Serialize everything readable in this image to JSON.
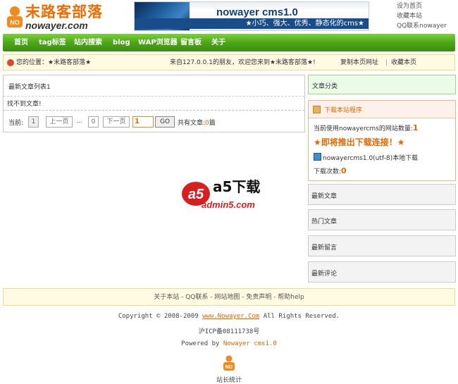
{
  "site": {
    "logo_title": "末路客部落",
    "logo_domain": "nowayer.com",
    "banner_title": "nowayer cms1.0",
    "banner_sub": "★小巧、强大、优秀、静态化的cms★",
    "toplinks": [
      "设为首页",
      "收藏本站",
      "QQ联系nowayer"
    ]
  },
  "nav": {
    "items": [
      "首页",
      "tag标签",
      "站内搜索",
      "blog",
      "WAP浏览器",
      "留言板",
      "关于"
    ]
  },
  "crumb": {
    "location": "您的位置：★末路客部落★",
    "welcome": "来自127.0.0.1的朋友，欢迎您来到★末路客部落★!",
    "copy_url": "复制本页网址",
    "separator": "|",
    "bookmark": "收藏本页"
  },
  "main": {
    "list_title": "最新文章列表1",
    "empty_text": "找不到文章!",
    "pager": {
      "label": "当前:",
      "current": "1",
      "prev": "上一页",
      "ellipsis": "...",
      "total_pages": "0",
      "next": "下一页",
      "input_value": "1",
      "go": "GO",
      "total_label": "共有文章:",
      "total_count": "0",
      "total_unit": "篇"
    }
  },
  "sidebar": {
    "category_title": "文章分类",
    "download": {
      "title": "下载本站程序",
      "count_label": "当前使用nowayercms的网站数量:",
      "count_value": "1",
      "announce": "★即将推出下载连接！★",
      "file_label": "nowayercms1.0(utf-8)本地下载",
      "dl_label": "下载次数:",
      "dl_value": "0"
    },
    "boxes": [
      "最新文章",
      "热门文章",
      "最新留言",
      "最新评论"
    ]
  },
  "watermark": {
    "brand": "a5下载",
    "domain": "admin5.com"
  },
  "footer": {
    "links": "关于本站 - QQ联系 - 网站地图 - 免责声明 - 帮助help",
    "copyright_pre": "Copyright © 2008-2009 ",
    "copyright_link": "www.Nowayer.Com",
    "copyright_post": " All Rights Reserved.",
    "icp": "沪ICP备08111738号",
    "powered_pre": "Powered by ",
    "powered_name": "Nowayer cms1.0",
    "stat": "站长统计"
  },
  "colors": {
    "accent_orange": "#e06a00",
    "nav_green": "#4ea619"
  }
}
